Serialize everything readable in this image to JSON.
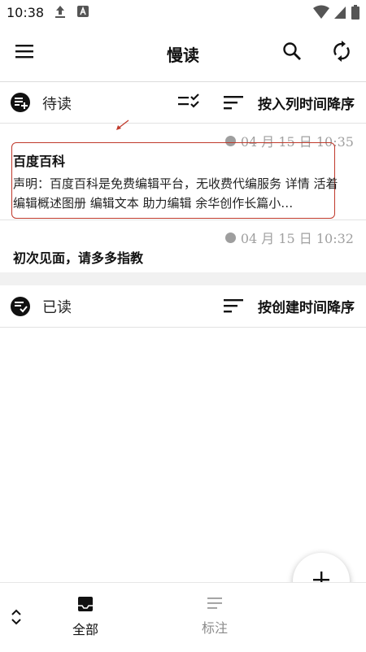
{
  "status_bar": {
    "time": "10:38"
  },
  "app_bar": {
    "title": "慢读"
  },
  "unread": {
    "label": "待读",
    "sort_label": "按入列时间降序",
    "items": [
      {
        "title": "百度百科",
        "timestamp": "04 月 15 日 10:35",
        "excerpt": "声明：百度百科是免费编辑平台，无收费代编服务 详情 活着 编辑概述图册 编辑文本 助力编辑 余华创作长篇小…"
      },
      {
        "title": "初次见面，请多多指教",
        "timestamp": "04 月 15 日 10:32",
        "excerpt": ""
      }
    ]
  },
  "read": {
    "label": "已读",
    "sort_label": "按创建时间降序"
  },
  "bottom_nav": {
    "tabs": [
      {
        "label": "全部",
        "icon": "inbox-icon",
        "active": true
      },
      {
        "label": "标注",
        "icon": "notes-icon",
        "active": false
      }
    ]
  },
  "colors": {
    "highlight_box": "#c0392b",
    "muted": "#a0a0a0"
  }
}
